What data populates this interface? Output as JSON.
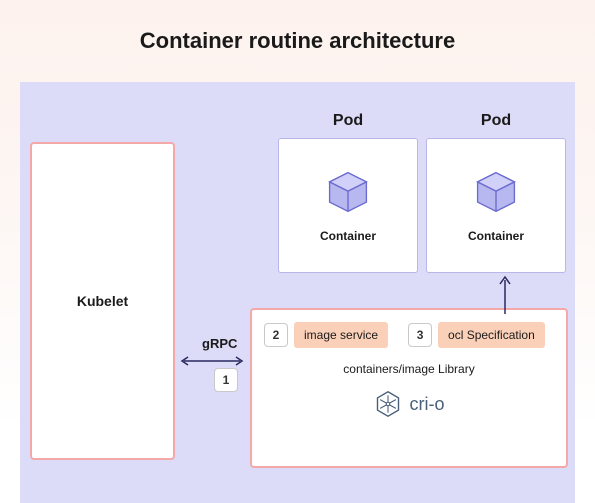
{
  "title": "Container routine architecture",
  "kubelet": "Kubelet",
  "pods": {
    "label": "Pod",
    "container": "Container"
  },
  "grpc": "gRPC",
  "badges": {
    "b1": "1",
    "b2": "2",
    "b3": "3"
  },
  "services": {
    "image_service": "image service",
    "ocl_spec": "ocl Specification"
  },
  "lib": "containers/image Library",
  "crio": "cri-o"
}
